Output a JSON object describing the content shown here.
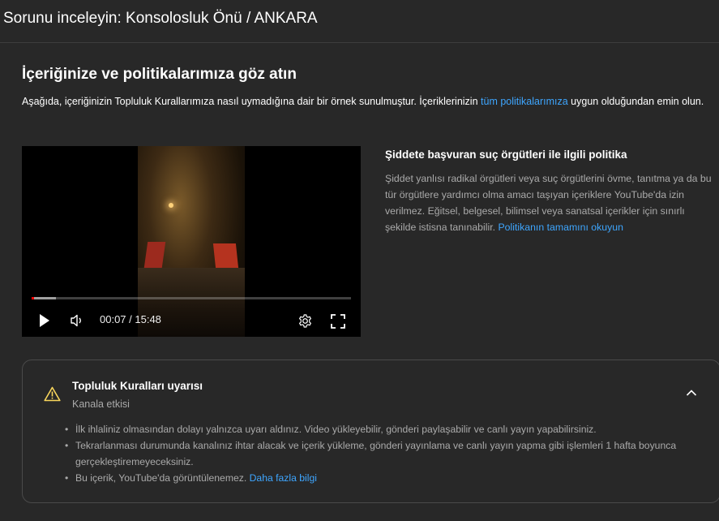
{
  "header": {
    "title": "Sorunu inceleyin: Konsolosluk Önü / ANKARA"
  },
  "section": {
    "title": "İçeriğinize ve politikalarımıza göz atın",
    "intro_before": "Aşağıda, içeriğinizin Topluluk Kurallarımıza nasıl uymadığına dair bir örnek sunulmuştur. İçeriklerinizin ",
    "intro_link": "tüm politikalarımıza",
    "intro_after": " uygun olduğundan emin olun."
  },
  "video": {
    "current_time": "00:07",
    "duration": "15:48",
    "time_display": "00:07 / 15:48",
    "progress_played_fraction": 0.007,
    "progress_loaded_fraction": 0.075
  },
  "policy": {
    "title": "Şiddete başvuran suç örgütleri ile ilgili politika",
    "text": "Şiddet yanlısı radikal örgütleri veya suç örgütlerini övme, tanıtma ya da bu tür örgütlere yardımcı olma amacı taşıyan içeriklere YouTube'da izin verilmez. Eğitsel, belgesel, bilimsel veya sanatsal içerikler için sınırlı şekilde istisna tanınabilir. ",
    "link": "Politikanın tamamını okuyun"
  },
  "warning_card": {
    "title": "Topluluk Kuralları uyarısı",
    "subtitle": "Kanala etkisi",
    "bullets": [
      "İlk ihlaliniz olmasından dolayı yalnızca uyarı aldınız. Video yükleyebilir, gönderi paylaşabilir ve canlı yayın yapabilirsiniz.",
      "Tekrarlanması durumunda kanalınız ihtar alacak ve içerik yükleme, gönderi yayınlama ve canlı yayın yapma gibi işlemleri 1 hafta boyunca gerçekleştiremeyeceksiniz.",
      "Bu içerik, YouTube'da görüntülenemez. "
    ],
    "learn_more": "Daha fazla bilgi"
  },
  "colors": {
    "background": "#282828",
    "link": "#3ea6ff",
    "warning": "#f9d65c",
    "progress": "#ff0000"
  },
  "icons": [
    "play-icon",
    "volume-icon",
    "settings-gear-icon",
    "fullscreen-icon",
    "warning-triangle-icon",
    "chevron-up-icon"
  ]
}
